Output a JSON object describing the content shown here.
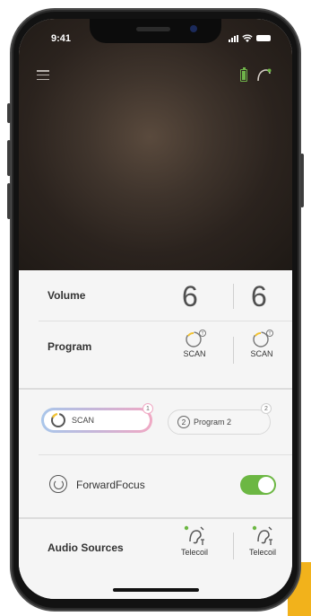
{
  "status_bar": {
    "time": "9:41"
  },
  "header": {
    "menu_icon": "menu-icon",
    "battery_icon": "battery-level-icon",
    "device_icon": "hearing-aid-icon"
  },
  "volume": {
    "label": "Volume",
    "left": "6",
    "right": "6"
  },
  "program": {
    "label": "Program",
    "left": "SCAN",
    "right": "SCAN"
  },
  "program_pills": [
    {
      "label": "SCAN",
      "badge": "1"
    },
    {
      "number": "2",
      "label": "Program 2",
      "badge": "2"
    }
  ],
  "forward_focus": {
    "label": "ForwardFocus",
    "enabled": true
  },
  "audio_sources": {
    "label": "Audio Sources",
    "left": "Telecoil",
    "right": "Telecoil"
  },
  "colors": {
    "accent_green": "#6cb743",
    "pill_blue": "#a9c6ea",
    "pill_pink": "#f0a9c4",
    "corner_accent": "#f2b21b"
  }
}
